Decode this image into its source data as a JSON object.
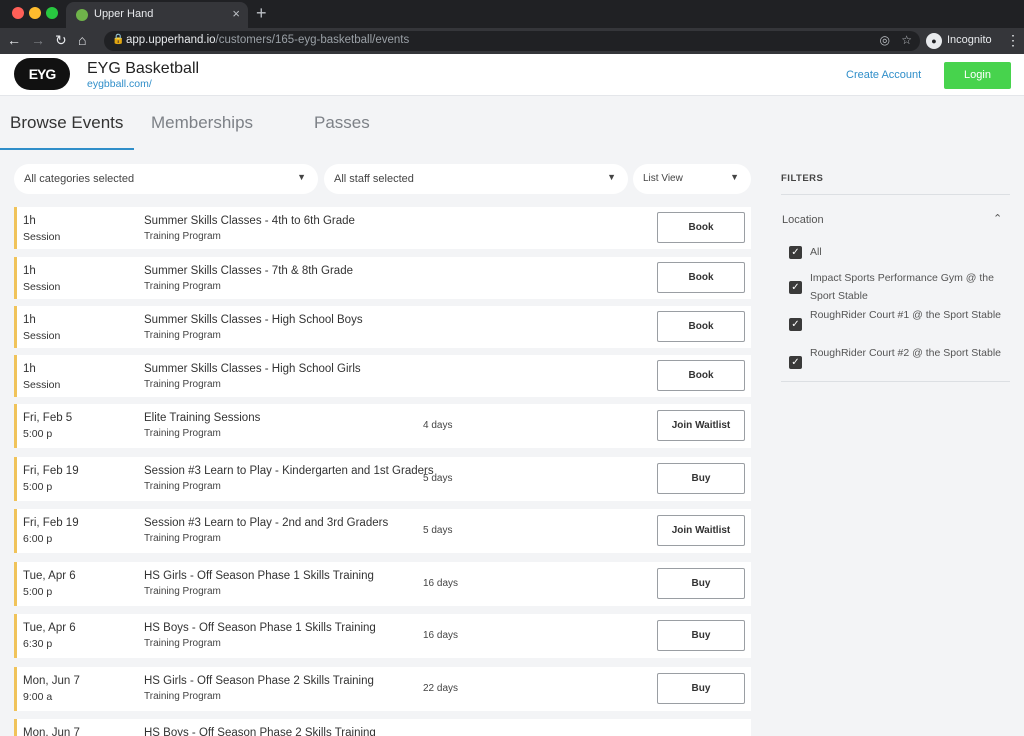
{
  "browser": {
    "tab_title": "Upper Hand",
    "new_tab": "+",
    "close_tab": "×",
    "url_host": "app.upperhand.io",
    "url_path": "/customers/165-eyg-basketball/events",
    "incognito_label": "Incognito",
    "icons": [
      "back-icon",
      "forward-icon",
      "reload-icon",
      "home-icon",
      "lock-icon",
      "eye-off-icon",
      "star-icon",
      "incognito-icon",
      "kebab-icon"
    ]
  },
  "header": {
    "logo_text": "EYG",
    "business_name": "EYG Basketball",
    "business_url": "eygbball.com/",
    "create_account": "Create Account",
    "login": "Login",
    "accent": "#2f8ec9",
    "login_color": "#47d34d"
  },
  "tabs": [
    {
      "label": "Browse Events",
      "active": true
    },
    {
      "label": "Memberships",
      "active": false
    },
    {
      "label": "Passes",
      "active": false
    }
  ],
  "filters_bar": {
    "categories": "All categories selected",
    "staff": "All staff selected",
    "view": "List View"
  },
  "events": [
    {
      "when": "1h",
      "sub": "Session",
      "title": "Summer Skills Classes - 4th to 6th Grade",
      "type": "Training Program",
      "days": "",
      "action": "Book"
    },
    {
      "when": "1h",
      "sub": "Session",
      "title": "Summer Skills Classes - 7th & 8th Grade",
      "type": "Training Program",
      "days": "",
      "action": "Book"
    },
    {
      "when": "1h",
      "sub": "Session",
      "title": "Summer Skills Classes - High School Boys",
      "type": "Training Program",
      "days": "",
      "action": "Book"
    },
    {
      "when": "1h",
      "sub": "Session",
      "title": "Summer Skills Classes - High School Girls",
      "type": "Training Program",
      "days": "",
      "action": "Book"
    },
    {
      "when": "Fri, Feb 5",
      "sub": "5:00 p",
      "title": "Elite Training Sessions",
      "type": "Training Program",
      "days": "4 days",
      "action": "Join Waitlist"
    },
    {
      "when": "Fri, Feb 19",
      "sub": "5:00 p",
      "title": "Session #3 Learn to Play - Kindergarten and 1st Graders",
      "type": "Training Program",
      "days": "5 days",
      "action": "Buy"
    },
    {
      "when": "Fri, Feb 19",
      "sub": "6:00 p",
      "title": "Session #3 Learn to Play - 2nd and 3rd Graders",
      "type": "Training Program",
      "days": "5 days",
      "action": "Join Waitlist"
    },
    {
      "when": "Tue, Apr 6",
      "sub": "5:00 p",
      "title": "HS Girls - Off Season Phase 1 Skills Training",
      "type": "Training Program",
      "days": "16 days",
      "action": "Buy"
    },
    {
      "when": "Tue, Apr 6",
      "sub": "6:30 p",
      "title": "HS Boys - Off Season Phase 1 Skills Training",
      "type": "Training Program",
      "days": "16 days",
      "action": "Buy"
    },
    {
      "when": "Mon, Jun 7",
      "sub": "9:00 a",
      "title": "HS Girls - Off Season Phase 2 Skills Training",
      "type": "Training Program",
      "days": "22 days",
      "action": "Buy"
    },
    {
      "when": "Mon, Jun 7",
      "sub": "",
      "title": "HS Boys - Off Season Phase 2 Skills Training",
      "type": "",
      "days": "",
      "action": ""
    }
  ],
  "sidebar": {
    "title": "FILTERS",
    "location_label": "Location",
    "locations": [
      {
        "label": "All",
        "checked": true
      },
      {
        "label": "Impact Sports Performance Gym @ the Sport Stable",
        "checked": true
      },
      {
        "label": "RoughRider Court #1 @ the Sport Stable",
        "checked": true
      },
      {
        "label": "RoughRider Court #2 @ the Sport Stable",
        "checked": true
      }
    ]
  },
  "colors": {
    "row_border": "#f0c35a",
    "page_bg": "#f3f4f6"
  }
}
